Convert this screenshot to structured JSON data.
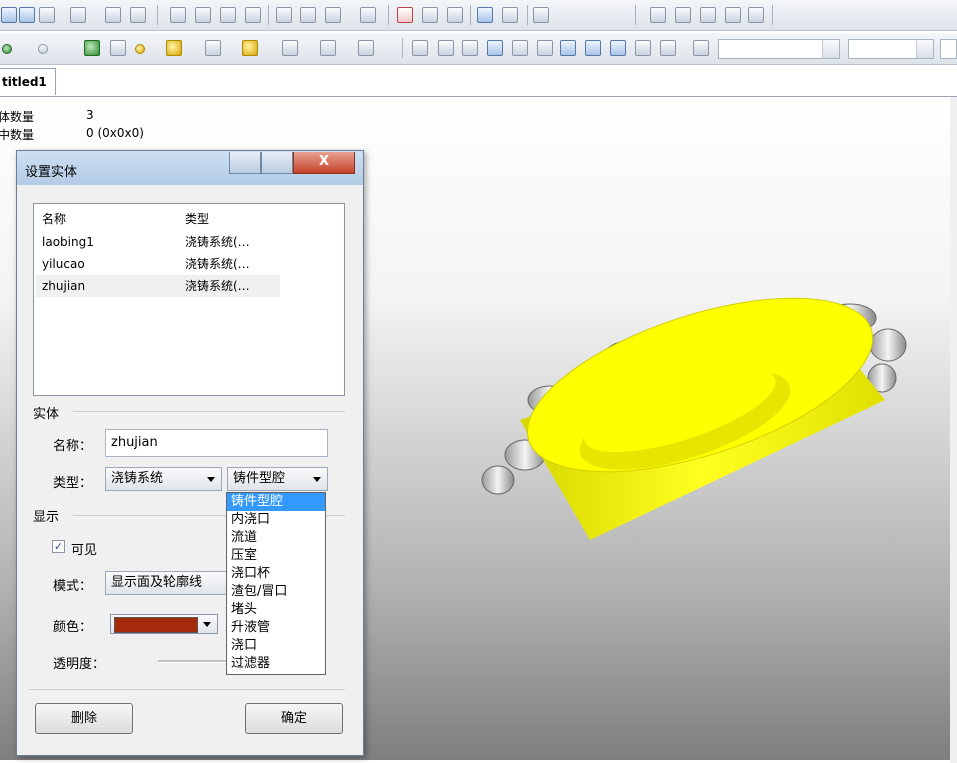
{
  "toolbar2": {
    "spin1_value": "",
    "spin2_value": ""
  },
  "tabs": [
    {
      "label": "titled1"
    }
  ],
  "info": [
    {
      "label": "实体数量",
      "value": "3"
    },
    {
      "label": "选中数量",
      "value": "0 (0x0x0)"
    }
  ],
  "dialog": {
    "title": "设置实体",
    "close_label": "X",
    "list": {
      "headers": [
        "名称",
        "类型"
      ],
      "rows": [
        {
          "name": "laobing1",
          "type": "浇铸系统(…"
        },
        {
          "name": "yilucao",
          "type": "浇铸系统(…"
        },
        {
          "name": "zhujian",
          "type": "浇铸系统(…"
        }
      ]
    },
    "entity_group": "实体",
    "name_label": "名称：",
    "name_value": "zhujian",
    "type_label": "类型：",
    "type_value": "浇铸系统",
    "subtype_value": "铸件型腔",
    "display_group": "显示",
    "visible_label": "可见",
    "visible_checked": true,
    "mode_label": "模式：",
    "mode_value": "显示面及轮廓线",
    "color_label": "颜色：",
    "color_value": "#a52a0c",
    "transparency_label": "透明度：",
    "delete_label": "删除",
    "ok_label": "确定",
    "subtype_options": [
      "铸件型腔",
      "内浇口",
      "流道",
      "压室",
      "浇口杯",
      "渣包/冒口",
      "堵头",
      "升液管",
      "浇口",
      "过滤器"
    ],
    "subtype_highlighted": 0
  },
  "colors": {
    "model_yellow": "#ffff00",
    "highlight": "#3399ff"
  }
}
